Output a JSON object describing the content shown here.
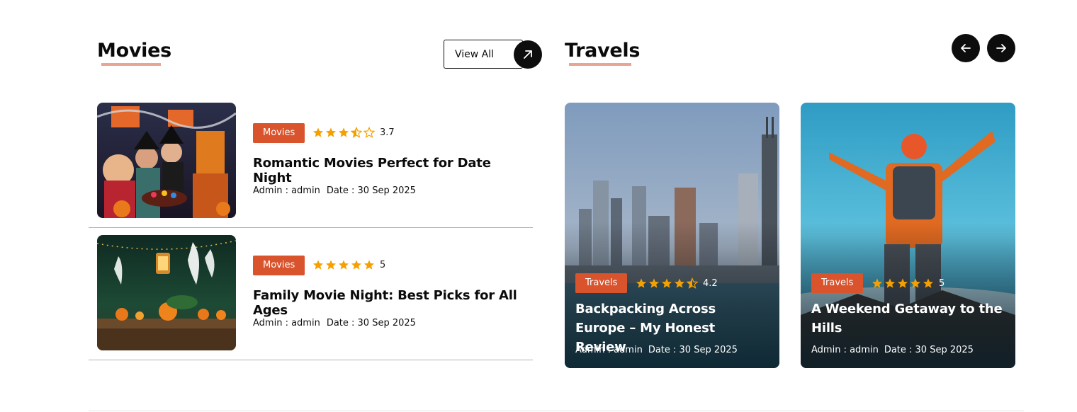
{
  "movies": {
    "title": "Movies",
    "view_all_label": "View All",
    "icon": "arrow-up-right-icon",
    "posts": [
      {
        "category": "Movies",
        "rating": 3.7,
        "rating_text": "3.7",
        "title": "Romantic Movies Perfect for Date Night",
        "author": "Admin : admin",
        "date": "Date : 30 Sep 2025",
        "image": "halloween-party-photo"
      },
      {
        "category": "Movies",
        "rating": 5,
        "rating_text": "5",
        "title": "Family Movie Night: Best Picks for All Ages",
        "author": "Admin : admin",
        "date": "Date : 30 Sep 2025",
        "image": "pumpkin-table-ghosts-photo"
      }
    ]
  },
  "travels": {
    "title": "Travels",
    "prev_icon": "arrow-left-icon",
    "next_icon": "arrow-right-icon",
    "posts": [
      {
        "category": "Travels",
        "rating": 4.2,
        "rating_text": "4.2",
        "title": "Backpacking Across Europe – My Honest Review",
        "author": "Admin : admin",
        "date": "Date : 30 Sep 2025",
        "image": "city-skyline-waterfront-photo"
      },
      {
        "category": "Travels",
        "rating": 5,
        "rating_text": "5",
        "title": "A Weekend Getaway to the Hills",
        "author": "Admin : admin",
        "date": "Date : 30 Sep 2025",
        "image": "hiker-on-summit-photo"
      }
    ]
  },
  "colors": {
    "accent": "#d9532c",
    "underline": "#e8a594",
    "star": "#f5a000",
    "dark": "#0d0d0d"
  }
}
